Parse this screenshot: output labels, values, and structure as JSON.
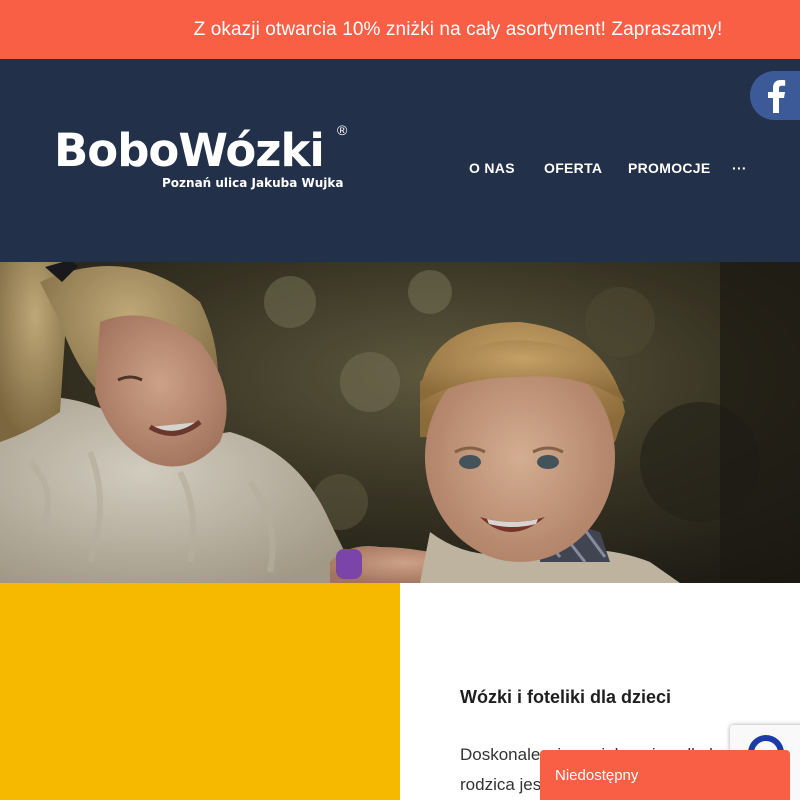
{
  "promo": {
    "text": "Z okazji otwarcia 10% zniżki na cały asortyment! Zapraszamy!"
  },
  "logo": {
    "name": "BoboWózki",
    "registered": "®",
    "tagline": "Poznań ulica Jakuba Wujka"
  },
  "nav": {
    "items": [
      {
        "label": "O NAS"
      },
      {
        "label": "OFERTA"
      },
      {
        "label": "PROMOCJE"
      },
      {
        "label": "···"
      }
    ]
  },
  "social": {
    "facebook_icon": "facebook-icon"
  },
  "content": {
    "title": "Wózki i foteliki dla dzieci",
    "text": "Doskonale wiemy, jak ważne dla każdego rodzica jest"
  },
  "status_tab": {
    "label": "Niedostępny"
  },
  "colors": {
    "promo_bar": "#f85f45",
    "header": "#23304a",
    "accent_yellow": "#f7b800",
    "facebook": "#3d5a98"
  }
}
